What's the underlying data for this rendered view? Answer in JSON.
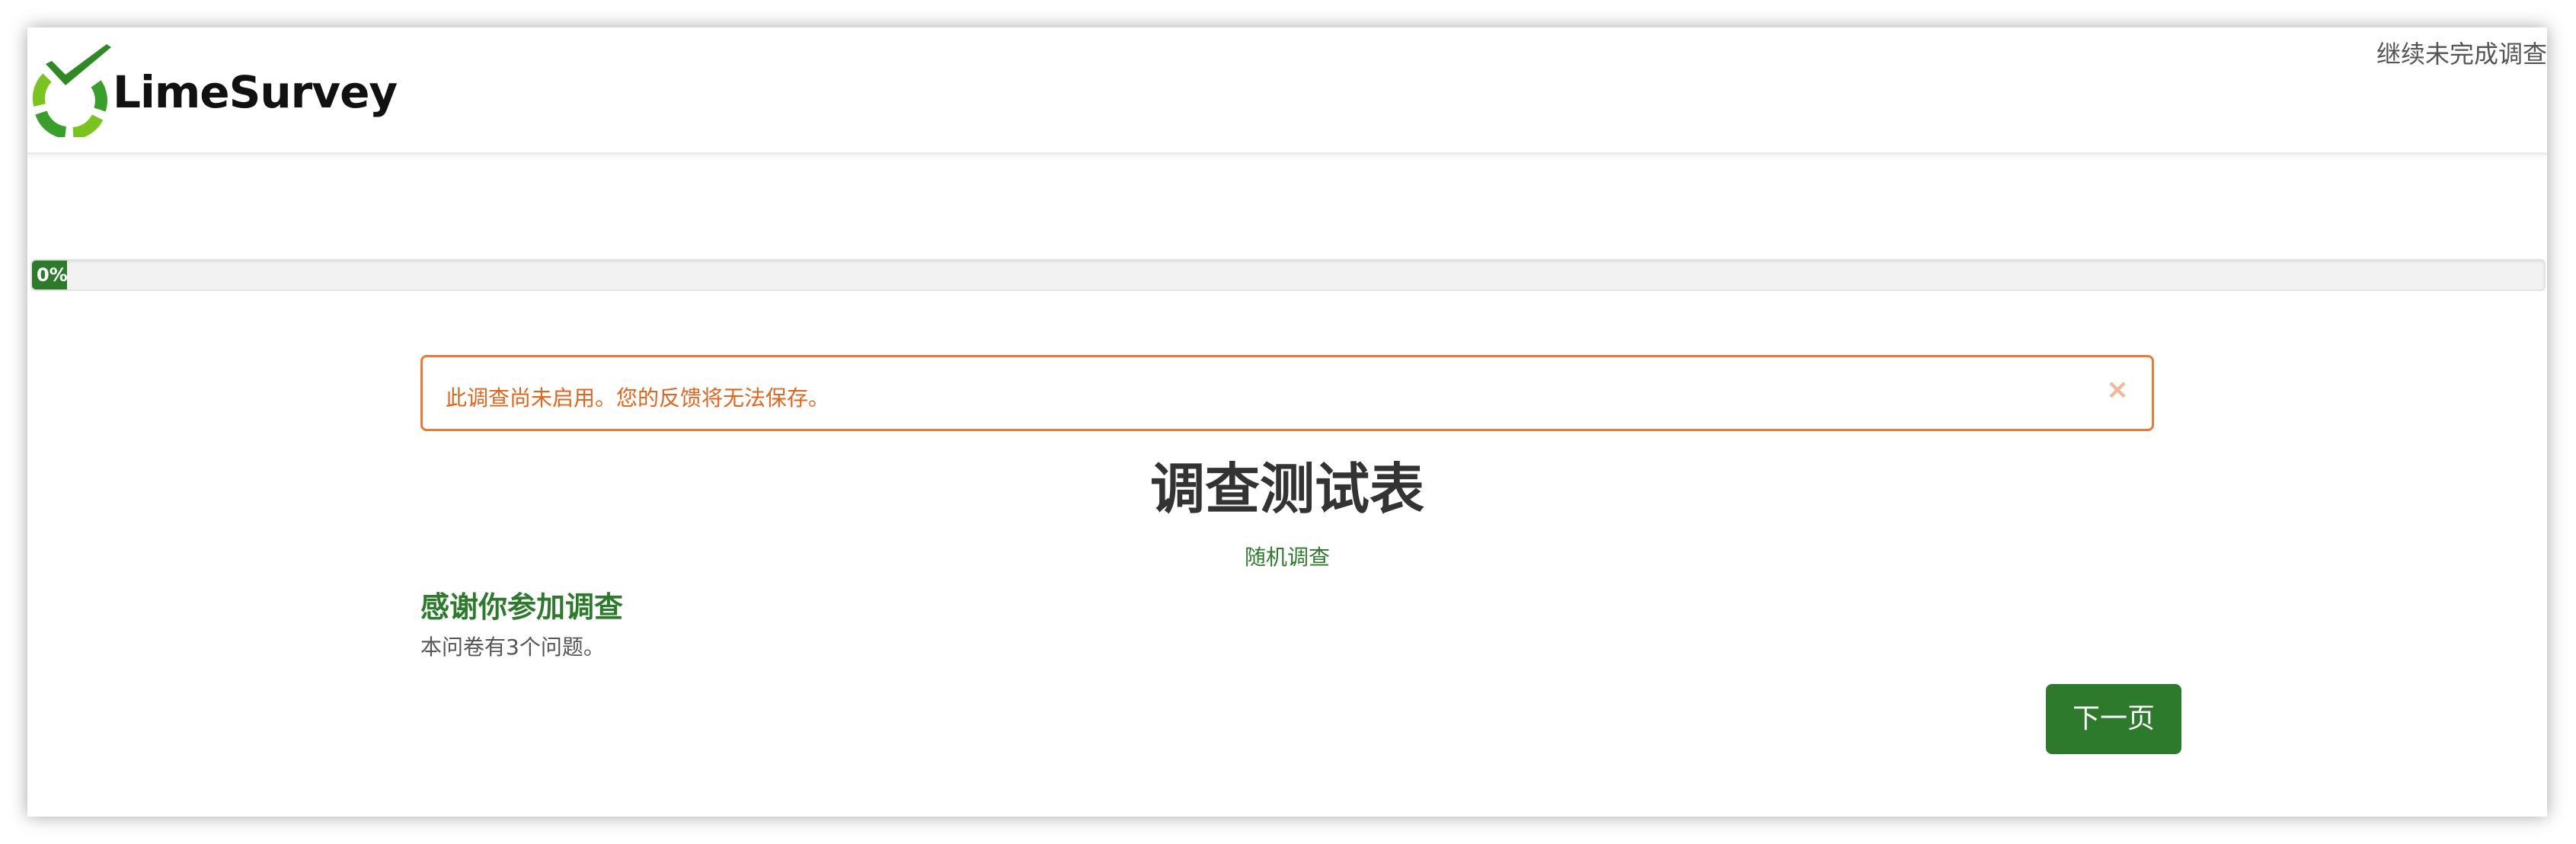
{
  "brand": {
    "name": "LimeSurvey",
    "primary_color": "#2d7a2d",
    "logo_green": "#7bc31f",
    "logo_check": "#3a9e2c"
  },
  "header": {
    "resume_link": "继续未完成调查"
  },
  "progress": {
    "percent": 0,
    "label": "0%"
  },
  "alert": {
    "message": "此调查尚未启用。您的反馈将无法保存。",
    "close_icon": "×",
    "color": "#e0651f"
  },
  "survey": {
    "title": "调查测试表",
    "subtitle": "随机调查",
    "welcome_heading": "感谢你参加调查",
    "question_count_text": "本问卷有3个问题。"
  },
  "navigation": {
    "next_label": "下一页"
  }
}
